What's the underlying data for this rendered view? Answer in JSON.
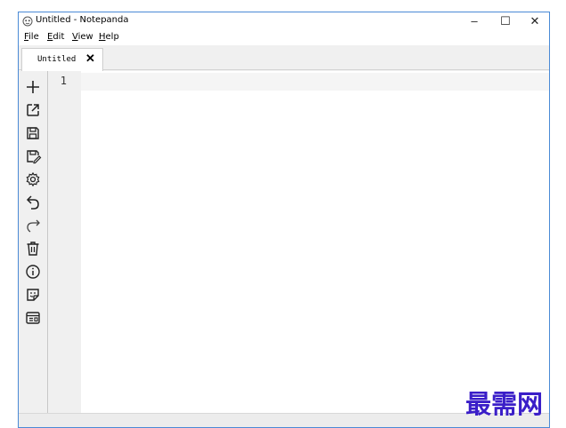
{
  "window": {
    "title": "Untitled - Notepanda",
    "controls": {
      "minimize": "–",
      "maximize": "☐",
      "close": "✕"
    }
  },
  "menubar": {
    "items": [
      {
        "label": "File"
      },
      {
        "label": "Edit"
      },
      {
        "label": "View"
      },
      {
        "label": "Help"
      }
    ]
  },
  "tabs": [
    {
      "label": "Untitled",
      "close": "✕",
      "active": true
    }
  ],
  "toolbar": {
    "tools": [
      {
        "icon": "plus-icon",
        "action": "new-file"
      },
      {
        "icon": "external-open-icon",
        "action": "open"
      },
      {
        "icon": "save-icon",
        "action": "save"
      },
      {
        "icon": "save-as-icon",
        "action": "save-as"
      },
      {
        "icon": "gear-icon",
        "action": "settings"
      },
      {
        "icon": "undo-icon",
        "action": "undo"
      },
      {
        "icon": "redo-icon",
        "action": "redo"
      },
      {
        "icon": "trash-icon",
        "action": "clear"
      },
      {
        "icon": "info-icon",
        "action": "about"
      },
      {
        "icon": "sticker-icon",
        "action": "sticky"
      },
      {
        "icon": "preview-icon",
        "action": "preview"
      }
    ]
  },
  "editor": {
    "line_numbers": [
      "1"
    ],
    "content": ""
  },
  "watermark": {
    "text": "最需网"
  },
  "colors": {
    "window_border": "#4a8ad6",
    "chrome_background": "#f0f0f0",
    "editor_background": "#ffffff",
    "watermark": "#3a1ec8"
  }
}
